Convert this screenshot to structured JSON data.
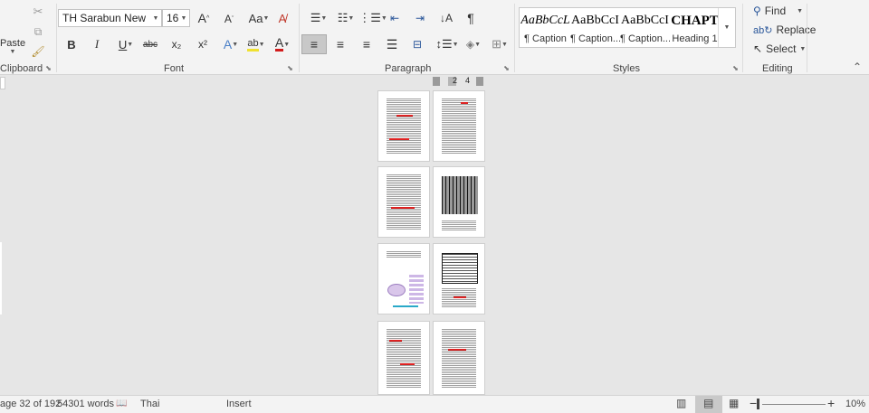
{
  "ribbon": {
    "clipboard": {
      "paste_label": "Paste",
      "group_label": "Clipboard"
    },
    "font": {
      "group_label": "Font",
      "font_name": "TH Sarabun New",
      "font_size": "16",
      "buttons": {
        "bold": "B",
        "italic": "I",
        "underline": "U",
        "strikethrough": "abc",
        "subscript": "x₂",
        "superscript": "x²",
        "grow": "A",
        "shrink": "A",
        "change_case": "Aa",
        "highlight": "ab",
        "font_color": "A",
        "text_effects": "A"
      },
      "font_color_hex": "#d21c1c"
    },
    "paragraph": {
      "group_label": "Paragraph",
      "show_marks": "¶"
    },
    "styles": {
      "group_label": "Styles",
      "items": [
        {
          "preview": "AaBbCcL",
          "name": "¶ Caption"
        },
        {
          "preview": "AaBbCcI",
          "name": "¶ Caption..."
        },
        {
          "preview": "AaBbCcI",
          "name": "¶ Caption..."
        },
        {
          "preview": "CHAPT",
          "name": "Heading 1"
        }
      ]
    },
    "editing": {
      "group_label": "Editing",
      "find": "Find",
      "replace": "Replace",
      "select": "Select"
    }
  },
  "navigator": {
    "page_a": "2",
    "page_b": "4"
  },
  "status": {
    "page": "age 32 of 192",
    "words": "54301 words",
    "language": "Thai",
    "mode": "Insert",
    "zoom": "10%",
    "zoom_level": 0.1
  },
  "colors": {
    "accent": "#2b579a",
    "underline_red": "#d22222"
  }
}
